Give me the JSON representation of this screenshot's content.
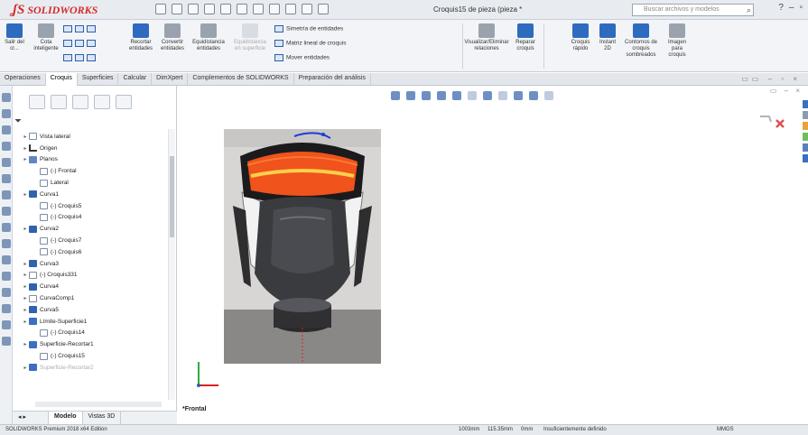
{
  "app": {
    "logo_brand": "SOLIDWORKS",
    "window_title": "Croquis15 de pieza (pieza *",
    "search_placeholder": "Buscar archivos y modelos"
  },
  "ribbon": {
    "exit_sketch": "Salir del cr...",
    "smart_dimension": "Cota inteligente",
    "trim": "Recortar entidades",
    "convert": "Convertir entidades",
    "offset": "Equidistancia entidades",
    "surface_offset": "Equidistancia en superficie",
    "mirror": "Simetría de entidades",
    "linear_pattern": "Matriz lineal de croquis",
    "move": "Mover entidades",
    "display_relations": "Visualizar/Eliminar relaciones",
    "repair": "Reparar croquis",
    "quick_snaps": "Croquis rápido",
    "instant2d": "Instant 2D",
    "shaded_contours": "Contornos de croquis sombreados",
    "sketch_picture": "Imagen para croquis"
  },
  "tabs": [
    {
      "label": "Operaciones",
      "active": false
    },
    {
      "label": "Croquis",
      "active": true
    },
    {
      "label": "Superficies",
      "active": false
    },
    {
      "label": "Calcular",
      "active": false
    },
    {
      "label": "DimXpert",
      "active": false
    },
    {
      "label": "Complementos de SOLIDWORKS",
      "active": false
    },
    {
      "label": "Preparación del análisis",
      "active": false
    }
  ],
  "tree": [
    {
      "label": "Vista lateral",
      "icon": "sketch",
      "indent": 1
    },
    {
      "label": "Origen",
      "icon": "origin",
      "indent": 1
    },
    {
      "label": "Planos",
      "icon": "folder",
      "indent": 1
    },
    {
      "label": "(-) Frontal",
      "icon": "sketch",
      "indent": 2
    },
    {
      "label": "Lateral",
      "icon": "sketch",
      "indent": 2
    },
    {
      "label": "Curva1",
      "icon": "curve",
      "indent": 1
    },
    {
      "label": "(-) Croquis5",
      "icon": "sketch",
      "indent": 2
    },
    {
      "label": "(-) Croquis4",
      "icon": "sketch",
      "indent": 2
    },
    {
      "label": "Curva2",
      "icon": "curve",
      "indent": 1
    },
    {
      "label": "(-) Croquis7",
      "icon": "sketch",
      "indent": 2
    },
    {
      "label": "(-) Croquis6",
      "icon": "sketch",
      "indent": 2
    },
    {
      "label": "Curva3",
      "icon": "curve",
      "indent": 1
    },
    {
      "label": "(-) Croquis331",
      "icon": "sketch",
      "indent": 1
    },
    {
      "label": "Curva4",
      "icon": "curve",
      "indent": 1
    },
    {
      "label": "CurvaComp1",
      "icon": "sketch",
      "indent": 1
    },
    {
      "label": "Curva5",
      "icon": "curve",
      "indent": 1
    },
    {
      "label": "Límite-Superficie1",
      "icon": "surface",
      "indent": 1
    },
    {
      "label": "(-) Croquis14",
      "icon": "sketch",
      "indent": 2
    },
    {
      "label": "Superficie-Recortar1",
      "icon": "surface",
      "indent": 1
    },
    {
      "label": "(-) Croquis15",
      "icon": "sketch",
      "indent": 2
    },
    {
      "label": "Superficie-Recortar2",
      "icon": "surface",
      "indent": 1,
      "dim": true
    }
  ],
  "panel_bottom": {
    "model_tab": "Modelo",
    "views_tab": "Vistas 3D"
  },
  "graphics": {
    "view_label": "*Frontal"
  },
  "status": {
    "edition": "SOLIDWORKS Premium 2018 x64 Edition",
    "x": "1003mm",
    "y": "115.35mm",
    "z": "0mm",
    "state": "Insuficientemente definido",
    "units": "MMGS"
  },
  "colors": {
    "accent": "#2e6bbf",
    "logo_red": "#d42a2a",
    "visor_orange": "#f0531c"
  }
}
